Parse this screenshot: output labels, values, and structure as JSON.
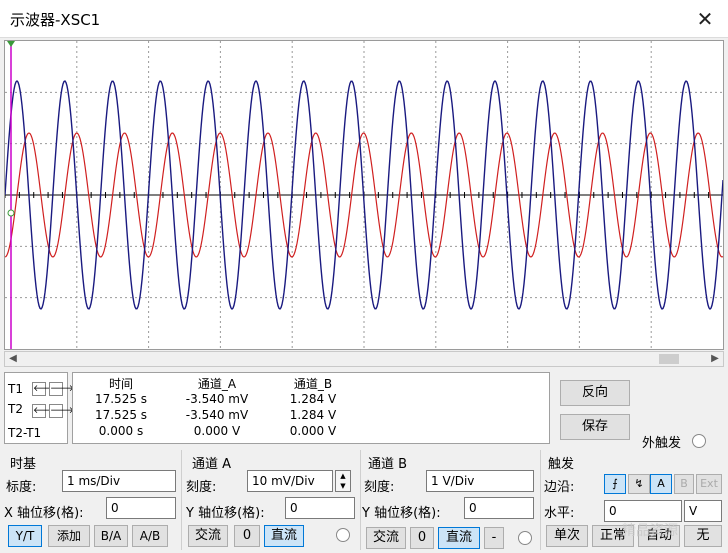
{
  "window": {
    "title": "示波器-XSC1",
    "close_glyph": "✕"
  },
  "colors": {
    "channel_a": "#d02020",
    "channel_b": "#1a1a80",
    "grid": "#9a9a9a",
    "trigger_marker": "#cc00cc"
  },
  "scroll": {
    "left_glyph": "◀",
    "right_glyph": "▶"
  },
  "cursor_labels": {
    "t1": "T1",
    "t2": "T2",
    "diff": "T2-T1",
    "left_glyph": "🡐",
    "right_glyph": "🡒"
  },
  "readout": {
    "headers": [
      "时间",
      "通道_A",
      "通道_B"
    ],
    "rows": [
      [
        "17.525 s",
        "-3.540 mV",
        "1.284 V"
      ],
      [
        "17.525 s",
        "-3.540 mV",
        "1.284 V"
      ],
      [
        "0.000 s",
        "0.000 V",
        "0.000 V"
      ]
    ]
  },
  "actions": {
    "reverse": "反向",
    "save": "保存",
    "ext_trigger": "外触发"
  },
  "timebase": {
    "title": "时基",
    "scale_label": "标度:",
    "scale_value": "1 ms/Div",
    "xpos_label": "X 轴位移(格):",
    "xpos_value": "0",
    "modes": [
      "Y/T",
      "添加",
      "B/A",
      "A/B"
    ]
  },
  "channel_a": {
    "title": "通道 A",
    "scale_label": "刻度:",
    "scale_value": "10 mV/Div",
    "ypos_label": "Y 轴位移(格):",
    "ypos_value": "0",
    "coupling": [
      "交流",
      "0",
      "直流"
    ]
  },
  "channel_b": {
    "title": "通道 B",
    "scale_label": "刻度:",
    "scale_value": "1  V/Div",
    "ypos_label": "Y 轴位移(格):",
    "ypos_value": "0",
    "coupling": [
      "交流",
      "0",
      "直流",
      "-"
    ]
  },
  "trigger": {
    "title": "触发",
    "edge_label": "边沿:",
    "edge_rise": "⨍",
    "edge_fall": "↯",
    "sources": [
      "A",
      "B",
      "Ext"
    ],
    "level_label": "水平:",
    "level_value": "0",
    "level_unit": "V",
    "modes": [
      "单次",
      "正常",
      "自动",
      "无"
    ]
  },
  "watermark": "精品资源"
}
